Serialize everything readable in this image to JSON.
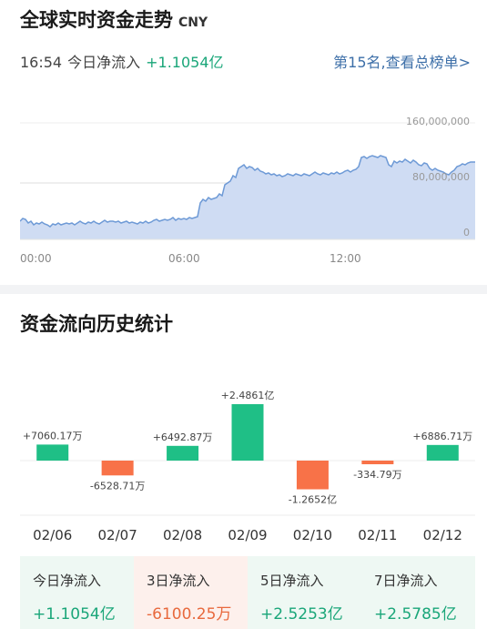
{
  "header": {
    "title": "全球实时资金走势",
    "unit": "CNY",
    "time": "16:54",
    "net_label": "今日净流入",
    "net_value": "+1.1054亿",
    "rank_link": "第15名,查看总榜单>"
  },
  "realtime_chart": {
    "yticks": [
      "160,000,000",
      "80,000,000",
      "0"
    ],
    "xticks": [
      "00:00",
      "06:00",
      "12:00"
    ],
    "colors": {
      "fill": "#cfdcf3",
      "line": "#6e9ad6"
    }
  },
  "history": {
    "title": "资金流向历史统计"
  },
  "chart_data": {
    "type": "bar",
    "categories": [
      "02/06",
      "02/07",
      "02/08",
      "02/09",
      "02/10",
      "02/11",
      "02/12"
    ],
    "values": [
      7060.17,
      -6528.71,
      6492.87,
      24861,
      -12652,
      -334.79,
      6886.71
    ],
    "labels": [
      "+7060.17万",
      "-6528.71万",
      "+6492.87万",
      "+2.4861亿",
      "-1.2652亿",
      "-334.79万",
      "+6886.71万"
    ],
    "colors": {
      "positive": "#1fbf86",
      "negative": "#f87248"
    }
  },
  "summary": [
    {
      "label": "今日净流入",
      "value": "+1.1054亿",
      "sign": "pos"
    },
    {
      "label": "3日净流入",
      "value": "-6100.25万",
      "sign": "neg"
    },
    {
      "label": "5日净流入",
      "value": "+2.5253亿",
      "sign": "pos"
    },
    {
      "label": "7日净流入",
      "value": "+2.5785亿",
      "sign": "pos"
    }
  ]
}
